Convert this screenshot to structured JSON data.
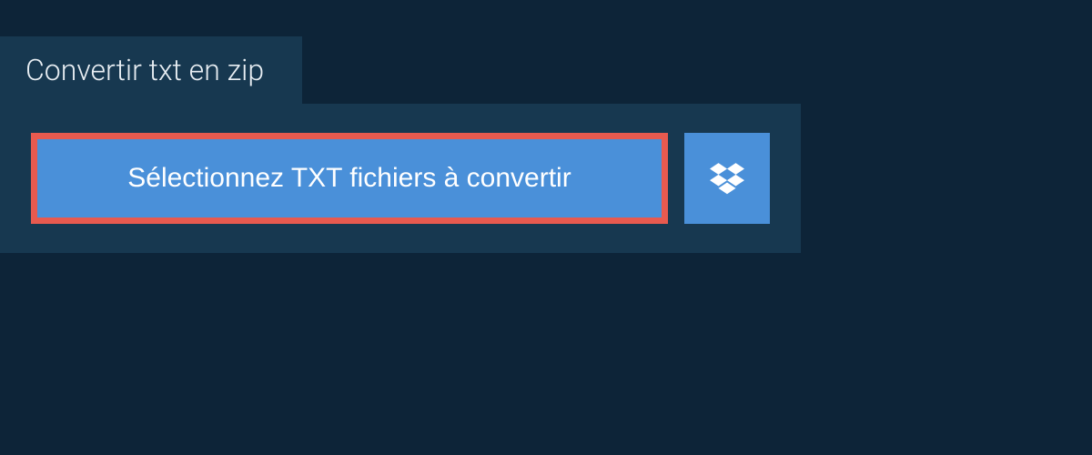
{
  "tab": {
    "label": "Convertir txt en zip"
  },
  "actions": {
    "select_files_label": "Sélectionnez TXT fichiers à convertir"
  }
}
